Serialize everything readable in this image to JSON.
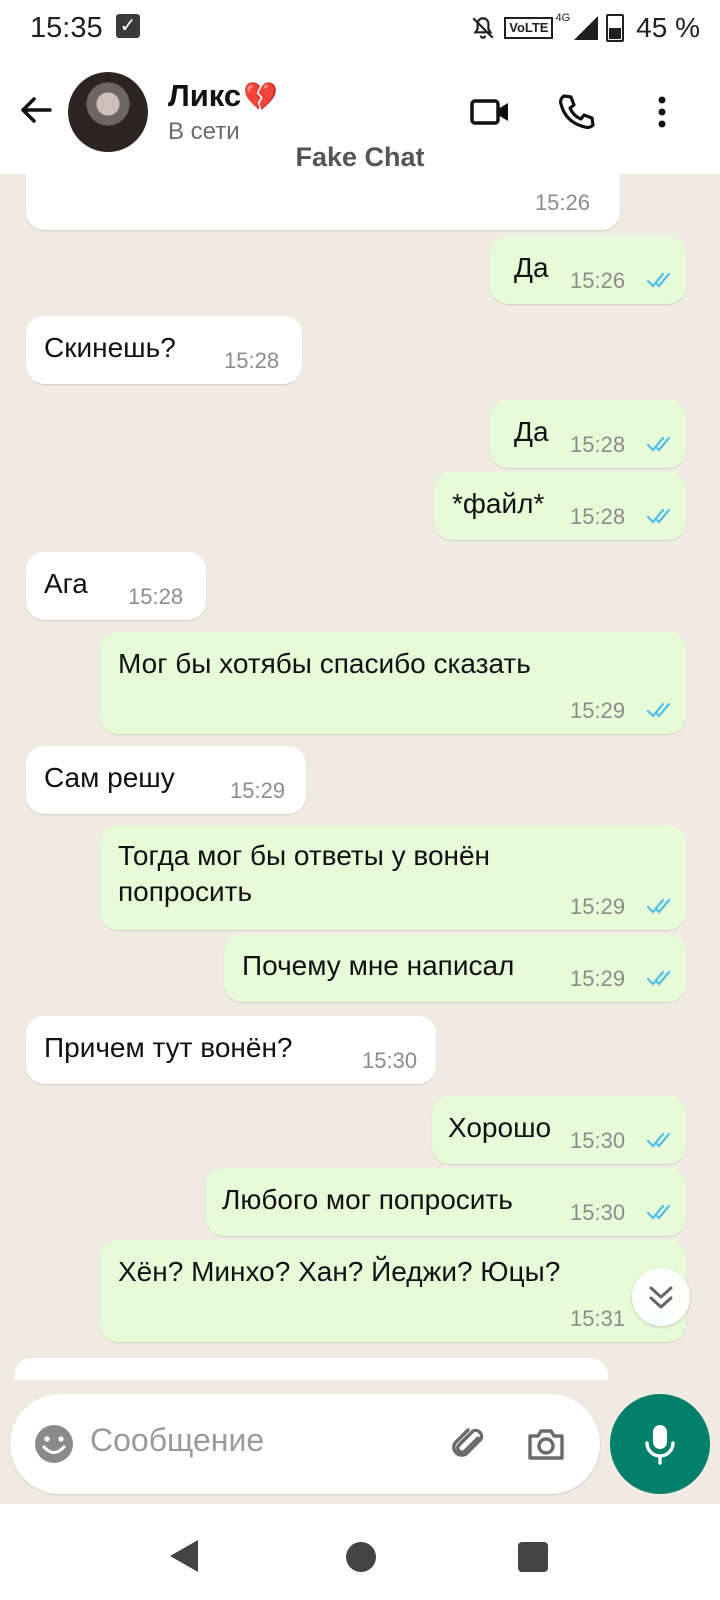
{
  "status_bar": {
    "time": "15:35",
    "volte": "VoLTE",
    "network": "4G",
    "battery": "45 %"
  },
  "header": {
    "contact_name": "Ликс",
    "status": "В сети",
    "watermark": "Fake Chat"
  },
  "colors": {
    "incoming": "#ffffff",
    "outgoing": "#e7fbd9",
    "ticks": "#53bdeb",
    "accent": "#008069",
    "background": "#efeae2"
  },
  "messages": [
    {
      "direction": "in",
      "text": "",
      "time": "15:26"
    },
    {
      "direction": "out",
      "text": "Да",
      "time": "15:26",
      "read": true
    },
    {
      "direction": "in",
      "text": "Скинешь?",
      "time": "15:28"
    },
    {
      "direction": "out",
      "text": "Да",
      "time": "15:28",
      "read": true
    },
    {
      "direction": "out",
      "text": "*файл*",
      "time": "15:28",
      "read": true
    },
    {
      "direction": "in",
      "text": "Ага",
      "time": "15:28"
    },
    {
      "direction": "out",
      "text": "Мог бы хотябы спасибо сказать",
      "time": "15:29",
      "read": true
    },
    {
      "direction": "in",
      "text": "Сам решу",
      "time": "15:29"
    },
    {
      "direction": "out",
      "text": "Тогда мог бы ответы у вонён попросить",
      "time": "15:29",
      "read": true
    },
    {
      "direction": "out",
      "text": "Почему мне написал",
      "time": "15:29",
      "read": true
    },
    {
      "direction": "in",
      "text": "Причем тут вонён?",
      "time": "15:30"
    },
    {
      "direction": "out",
      "text": "Хорошо",
      "time": "15:30",
      "read": true
    },
    {
      "direction": "out",
      "text": "Любого мог попросить",
      "time": "15:30",
      "read": true
    },
    {
      "direction": "out",
      "text": "Хён? Минхо? Хан? Йеджи? Юцы?",
      "time": "15:31",
      "read": true
    }
  ],
  "input": {
    "placeholder": "Сообщение"
  }
}
